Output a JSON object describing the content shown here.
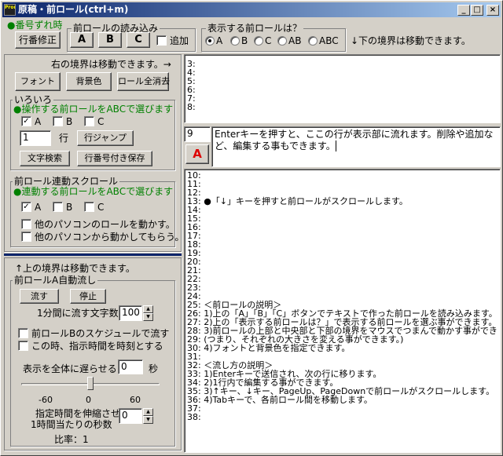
{
  "window": {
    "title": "原稿・前ロール(ctrl+m)",
    "icon_text": "Prompter"
  },
  "toolbar": {
    "line_num_offset_label": "●番号ずれ時",
    "line_num_fix_button": "行番修正",
    "load_group_label": "前ロールの読み込み",
    "btn_a": "A",
    "btn_b": "B",
    "btn_c": "C",
    "append_label": "追加",
    "display_group_label": "表示する前ロールは？",
    "radio_options": [
      "A",
      "B",
      "C",
      "AB",
      "ABC"
    ],
    "radio_selected": "A",
    "boundary_hint": "↓下の境界は移動できます。"
  },
  "left": {
    "right_boundary_hint": "右の境界は移動できます。→",
    "font_button": "フォント",
    "bgcolor_button": "背景色",
    "clear_all_button": "ロール全消去",
    "misc_group_label": "いろいろ",
    "misc_choose_text": "●操作する前ロールをABCで選びます",
    "misc_checks": [
      {
        "label": "A",
        "checked": true
      },
      {
        "label": "B",
        "checked": false
      },
      {
        "label": "C",
        "checked": false
      }
    ],
    "line_value": "1",
    "line_unit": "行",
    "line_jump_button": "行ジャンプ",
    "text_search_button": "文字検索",
    "save_with_num_button": "行番号付き保存",
    "scroll_group_label": "前ロール連動スクロール",
    "scroll_choose_text": "●連動する前ロールをABCで選びます",
    "scroll_checks": [
      {
        "label": "A",
        "checked": true
      },
      {
        "label": "B",
        "checked": false
      },
      {
        "label": "C",
        "checked": false
      }
    ],
    "move_other_pc": "他のパソコンのロールを動かす。",
    "moved_by_other_pc": "他のパソコンから動かしてもらう。",
    "up_boundary_hint": "↑上の境界は移動できます。",
    "auto_group_label": "前ロールA自動流し",
    "flow_button": "流す",
    "stop_button": "停止",
    "chars_per_min_label": "1分間に流す文字数",
    "chars_per_min_value": "100",
    "schedule_b_label": "前ロールBのスケジュールで流す",
    "schedule_time_label": "この時、指示時間を時刻とする",
    "delay_label": "表示を全体に遅らせる",
    "delay_value": "0",
    "delay_unit": "秒",
    "slider_ticks": [
      "-60",
      "0",
      "60"
    ],
    "slider_value": 0,
    "stretch_label_1": "指定時間を伸縮させる",
    "stretch_label_2": "1時間当たりの秒数",
    "stretch_value": "0",
    "ratio_label": "比率：1"
  },
  "top_panel": {
    "lines": [
      "3:",
      "4:",
      "5:",
      "6:",
      "7:",
      "8:"
    ]
  },
  "edit": {
    "line_number": "9",
    "roll_label": "A",
    "text": "Enterキーを押すと、ここの行が表示部に流れます。削除や追加など、編集する事もできます。"
  },
  "main_panel": {
    "lines": [
      "10:",
      "11:",
      "12:",
      "13: ●「↓」キーを押すと前ロールがスクロールします。",
      "14:",
      "15:",
      "16:",
      "17:",
      "18:",
      "19:",
      "20:",
      "21:",
      "22:",
      "23:",
      "24:",
      "25: ＜前ロールの説明＞",
      "26: 1)上の「A」「B」「C」ボタンでテキストで作った前ロールを読み込みます。",
      "27: 2)上の「表示する前ロールは？」で表示する前ロールを選ぶ事ができます。",
      "28: 3)前ロールの上部と中央部と下部の境界をマウスでつまんで動かす事ができ",
      "29: (つまり、それぞれの大きさを変える事ができます。)",
      "30: 4)フォントと背景色を指定できます。",
      "31:",
      "32: ＜流し方の説明＞",
      "33: 1)Enterキーで送信され、次の行に移ります。",
      "34: 2)1行内で編集する事ができます。",
      "35: 3)↑キー、↓キー、PageUp、PageDownで前ロールがスクロールします。",
      "36: 4)Tabキーで、各前ロール間を移動します。",
      "37:",
      "38:"
    ]
  }
}
